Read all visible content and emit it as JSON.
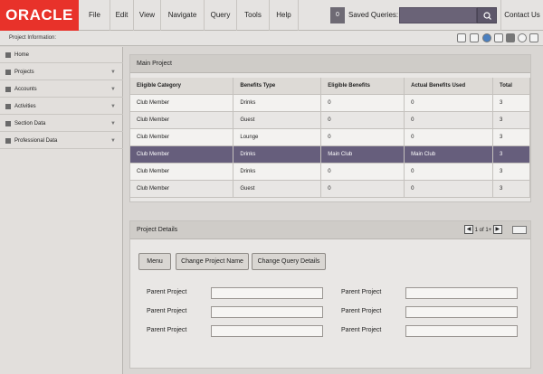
{
  "header": {
    "logo_text": "ORACLE",
    "menu": [
      "File",
      "Edit",
      "View",
      "Navigate",
      "Query",
      "Tools",
      "Help"
    ],
    "saved_queries_count": "0",
    "saved_queries_label": "Saved Queries:",
    "search_value": "",
    "contact_label": "Contact Us"
  },
  "breadcrumb": {
    "label": "Project Information:"
  },
  "sidebar": {
    "items": [
      {
        "label": "Home",
        "icon": "home-icon"
      },
      {
        "label": "Projects",
        "icon": "projects-icon"
      },
      {
        "label": "Accounts",
        "icon": "accounts-icon"
      },
      {
        "label": "Activities",
        "icon": "activities-icon"
      },
      {
        "label": "Section Data",
        "icon": "section-data-icon"
      },
      {
        "label": "Professional Data",
        "icon": "professional-data-icon"
      }
    ]
  },
  "main_project": {
    "title": "Main Project",
    "columns": [
      "Eligible Category",
      "Benefits Type",
      "Eligible Benefits",
      "Actual Benefits Used",
      "Total"
    ],
    "rows": [
      [
        "Club Member",
        "Drinks",
        "0",
        "0",
        "3"
      ],
      [
        "Club Member",
        "Guest",
        "0",
        "0",
        "3"
      ],
      [
        "Club Member",
        "Lounge",
        "0",
        "0",
        "3"
      ],
      [
        "Club Member",
        "Drinks",
        "Main Club",
        "Main Club",
        "3"
      ],
      [
        "Club Member",
        "Drinks",
        "0",
        "0",
        "3"
      ],
      [
        "Club Member",
        "Guest",
        "0",
        "0",
        "3"
      ]
    ],
    "selected_row": 3
  },
  "project_details": {
    "title": "Project Details",
    "pager_text": "1 of 1+",
    "buttons": [
      "Menu",
      "Change Project Name",
      "Change Query Details"
    ],
    "fields": [
      {
        "label": "Parent Project",
        "value": ""
      },
      {
        "label": "Parent Project",
        "value": ""
      },
      {
        "label": "Parent Project",
        "value": ""
      },
      {
        "label": "Parent Project",
        "value": ""
      },
      {
        "label": "Parent Project",
        "value": ""
      },
      {
        "label": "Parent Project",
        "value": ""
      }
    ]
  },
  "colors": {
    "brand": "#e8322a",
    "selected_row": "#665e7c",
    "search_bg": "#6a6377"
  }
}
